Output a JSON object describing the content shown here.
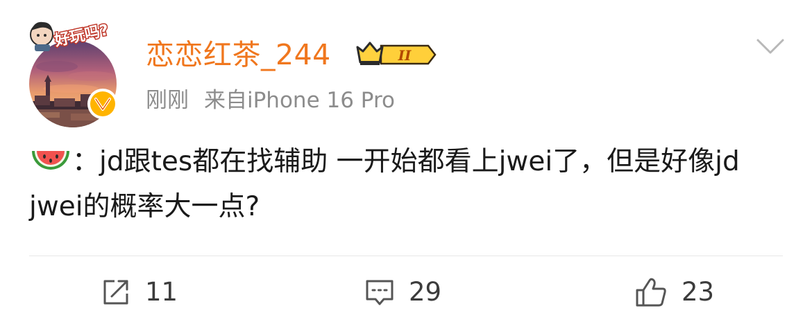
{
  "post": {
    "username": "恋恋红茶_244",
    "member_level": "II",
    "time": "刚刚",
    "source": "来自iPhone 16 Pro",
    "avatar_sticker_text": "好玩吗?",
    "content_emoji": "watermelon-emoji",
    "content_text": "：jd跟tes都在找辅助 一开始都看上jwei了，但是好像jd jwei的概率大一点?"
  },
  "actions": {
    "repost_count": "11",
    "comment_count": "29",
    "like_count": "23"
  },
  "colors": {
    "username": "#f0771e",
    "meta": "#8c8c8c",
    "text": "#1a1a1a",
    "badge_gold": "#ffb400",
    "divider": "#e6e6e6"
  },
  "icons": {
    "repost": "repost-icon",
    "comment": "comment-icon",
    "like": "thumbs-up-icon",
    "menu": "chevron-down-icon"
  }
}
